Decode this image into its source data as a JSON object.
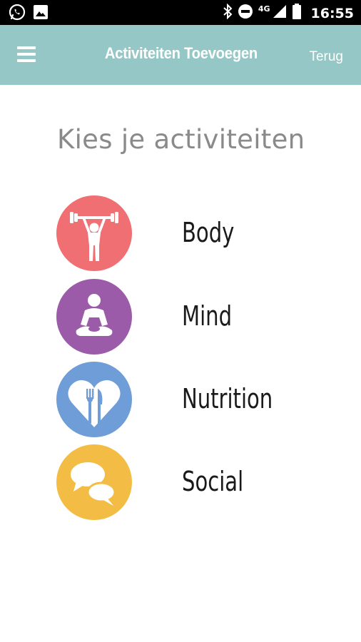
{
  "status_bar": {
    "time": "16:55",
    "network": "4G",
    "icons": [
      "whatsapp-icon",
      "image-icon",
      "bluetooth-icon",
      "do-not-disturb-icon",
      "signal-icon",
      "battery-icon"
    ]
  },
  "toolbar": {
    "title": "Activiteiten Toevoegen",
    "back_label": "Terug",
    "menu_icon": "hamburger-menu-icon",
    "background_color": "#94c7c5"
  },
  "heading": "Kies je activiteiten",
  "activities": [
    {
      "label": "Body",
      "icon": "weightlifter-icon",
      "color": "#ef6f72"
    },
    {
      "label": "Mind",
      "icon": "meditation-icon",
      "color": "#9b5ba8"
    },
    {
      "label": "Nutrition",
      "icon": "heart-fork-knife-icon",
      "color": "#6f9dd8"
    },
    {
      "label": "Social",
      "icon": "chat-bubbles-icon",
      "color": "#f3bd45"
    }
  ]
}
